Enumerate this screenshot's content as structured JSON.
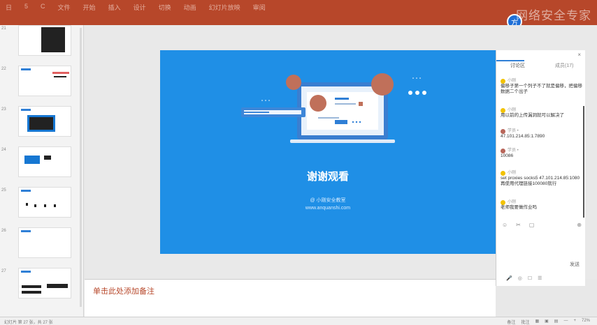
{
  "titlebar": {
    "menu": [
      "日",
      "5",
      "C",
      "文件",
      "开始",
      "插入",
      "设计",
      "切换",
      "动画",
      "幻灯片放映",
      "审阅"
    ],
    "watermark": "网络安全专家"
  },
  "thumbnails": [
    {
      "num": "21"
    },
    {
      "num": "22"
    },
    {
      "num": "23"
    },
    {
      "num": "24"
    },
    {
      "num": "25"
    },
    {
      "num": "26"
    },
    {
      "num": "27"
    }
  ],
  "slide": {
    "title": "谢谢观看",
    "subtitle": "@ 小刚安全教室",
    "url": "www.anquanshi.com"
  },
  "chat": {
    "tab_discussion": "讨论区",
    "tab_members": "成员(17)",
    "close": "×",
    "messages": [
      {
        "who": "小刚",
        "text": "偏移子第一个列子不了就是偏移，把偏移数据二个出子"
      },
      {
        "who": "小刚",
        "text": "用以前的上传漏洞就可以解决了"
      },
      {
        "who": "学员 •",
        "text": "47.101.214.85:1.7890"
      },
      {
        "who": "学员 •",
        "text": "10086"
      },
      {
        "who": "小刚",
        "text": "set proxies socks5 47.101.214.85:1080 再使用代理链接100080就行"
      },
      {
        "who": "小刚",
        "text": "老师我要做作业吗"
      }
    ],
    "send_label": "发送",
    "tools": [
      "☺",
      "✂",
      "▢",
      "⊕"
    ],
    "bottom": [
      "🎤",
      "◎",
      "☐",
      "☰"
    ]
  },
  "notes": {
    "placeholder": "单击此处添加备注"
  },
  "statusbar": {
    "left": "幻灯片 第 27 张，共 27 张",
    "right": [
      "备注",
      "批注",
      "▦",
      "▣",
      "▤",
      "—",
      "+",
      "72%"
    ]
  },
  "colors": {
    "titlebar": "#b7472a",
    "slide_bg": "#1f8fe6",
    "accent": "#2f7fd6"
  }
}
